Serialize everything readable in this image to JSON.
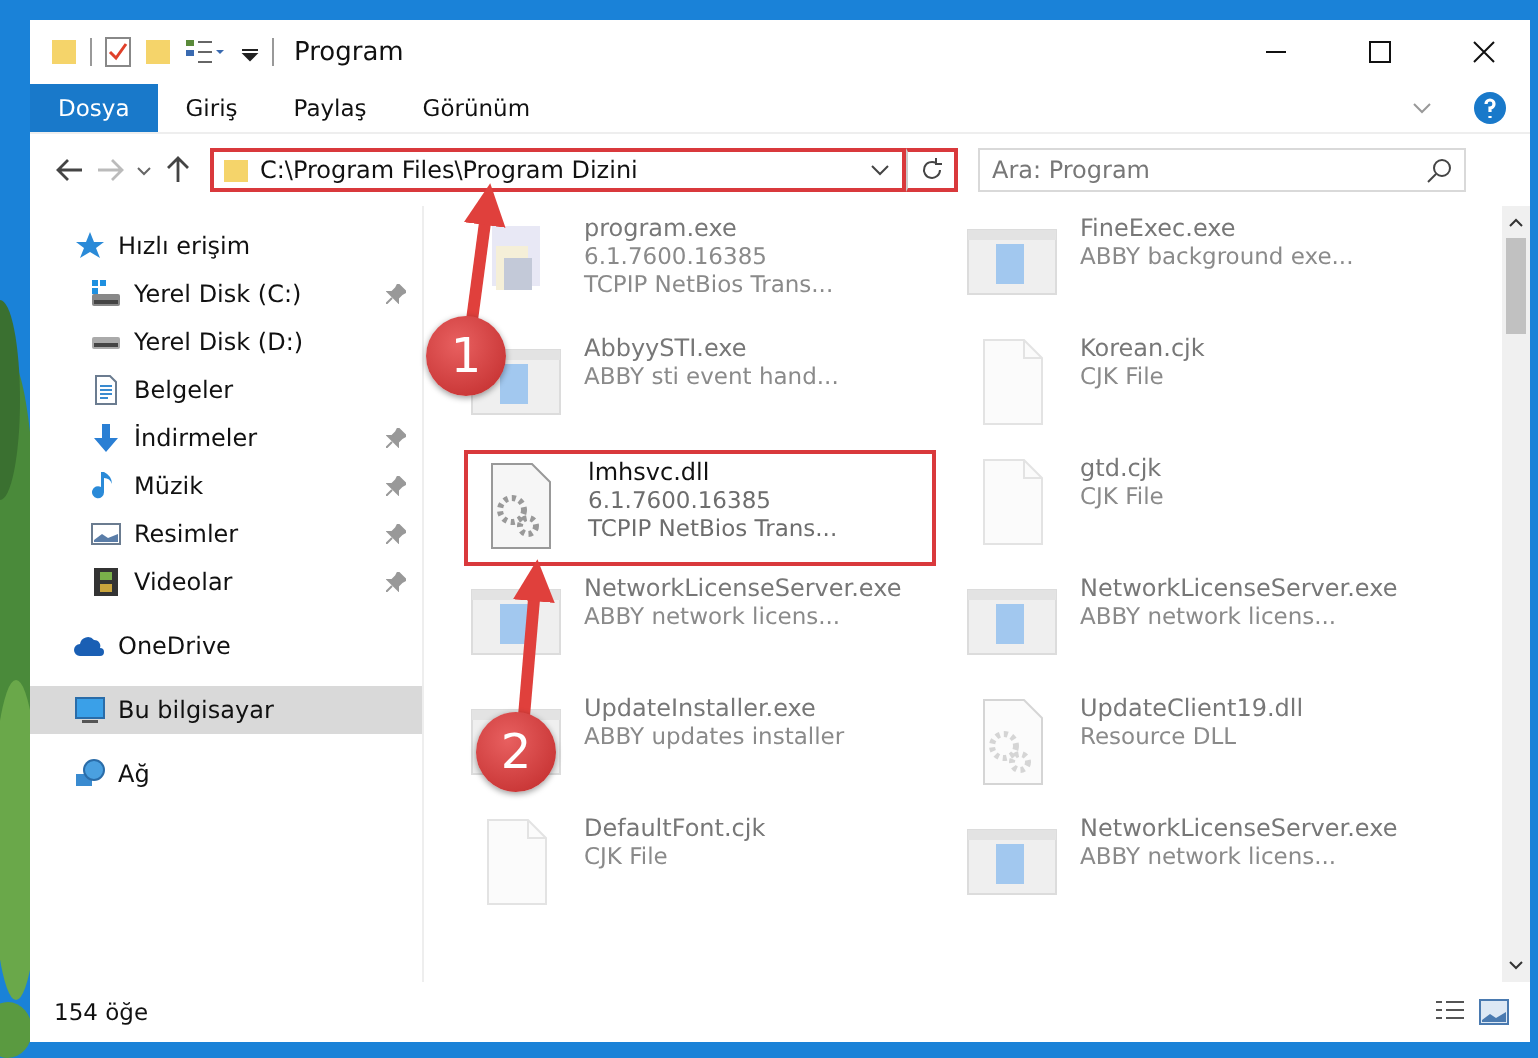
{
  "window": {
    "title": "Program"
  },
  "ribbon_tabs": [
    {
      "label": "Dosya",
      "selected": true
    },
    {
      "label": "Giriş",
      "selected": false
    },
    {
      "label": "Paylaş",
      "selected": false
    },
    {
      "label": "Görünüm",
      "selected": false
    }
  ],
  "address": {
    "path": "C:\\Program Files\\Program Dizini",
    "highlighted": true
  },
  "search": {
    "placeholder": "Ara: Program"
  },
  "sidebar": {
    "items": [
      {
        "label": "Hızlı erişim",
        "kind": "star",
        "selected": false,
        "children": [
          {
            "label": "Yerel Disk (C:)",
            "kind": "drive-win",
            "pinned": true,
            "selected": false
          },
          {
            "label": "Yerel Disk (D:)",
            "kind": "drive",
            "pinned": false,
            "selected": false
          },
          {
            "label": "Belgeler",
            "kind": "document",
            "pinned": false,
            "selected": false
          },
          {
            "label": "İndirmeler",
            "kind": "download",
            "pinned": true,
            "selected": false
          },
          {
            "label": "Müzik",
            "kind": "music",
            "pinned": true,
            "selected": false
          },
          {
            "label": "Resimler",
            "pinned": true,
            "selected": false
          },
          {
            "label": "Videolar",
            "kind": "film",
            "pinned": true,
            "selected": false
          }
        ]
      },
      {
        "label": "OneDrive",
        "kind": "cloud",
        "selected": false
      },
      {
        "label": "Bu bilgisayar",
        "kind": "computer",
        "selected": true
      },
      {
        "label": "Ağ",
        "kind": "network",
        "selected": false
      }
    ]
  },
  "files": [
    {
      "name": "program.exe",
      "details": [
        "6.1.7600.16385",
        "TCPIP NetBios Trans..."
      ],
      "kind": "installer",
      "faded": true,
      "highlighted": false
    },
    {
      "name": "FineExec.exe",
      "details": [
        "ABBY background exe..."
      ],
      "kind": "window",
      "faded": true,
      "highlighted": false
    },
    {
      "name": "AbbyySTI.exe",
      "details": [
        "ABBY sti event hand..."
      ],
      "kind": "window",
      "faded": true,
      "highlighted": false
    },
    {
      "name": "Korean.cjk",
      "details": [
        "CJK File"
      ],
      "kind": "blank",
      "faded": true,
      "highlighted": false
    },
    {
      "name": "lmhsvc.dll",
      "details": [
        "6.1.7600.16385",
        "TCPIP NetBios Trans..."
      ],
      "kind": "gear",
      "faded": false,
      "highlighted": true
    },
    {
      "name": "gtd.cjk",
      "details": [
        "CJK File"
      ],
      "kind": "blank",
      "faded": true,
      "highlighted": false
    },
    {
      "name": "NetworkLicenseServer.exe",
      "details": [
        "ABBY network licens..."
      ],
      "kind": "window",
      "faded": true,
      "highlighted": false
    },
    {
      "name": "NetworkLicenseServer.exe",
      "details": [
        "ABBY network licens..."
      ],
      "kind": "window",
      "faded": true,
      "highlighted": false
    },
    {
      "name": "UpdateInstaller.exe",
      "details": [
        "ABBY updates installer"
      ],
      "kind": "window",
      "faded": true,
      "highlighted": false
    },
    {
      "name": "UpdateClient19.dll",
      "details": [
        "Resource DLL"
      ],
      "kind": "gear",
      "faded": true,
      "highlighted": false
    },
    {
      "name": "DefaultFont.cjk",
      "details": [
        "CJK File"
      ],
      "kind": "blank",
      "faded": true,
      "highlighted": false
    },
    {
      "name": "NetworkLicenseServer.exe",
      "details": [
        "ABBY network licens..."
      ],
      "kind": "window",
      "faded": true,
      "highlighted": false
    }
  ],
  "annotations": [
    {
      "number": "1"
    },
    {
      "number": "2"
    }
  ],
  "status_bar": {
    "item_count": "154 öğe"
  }
}
